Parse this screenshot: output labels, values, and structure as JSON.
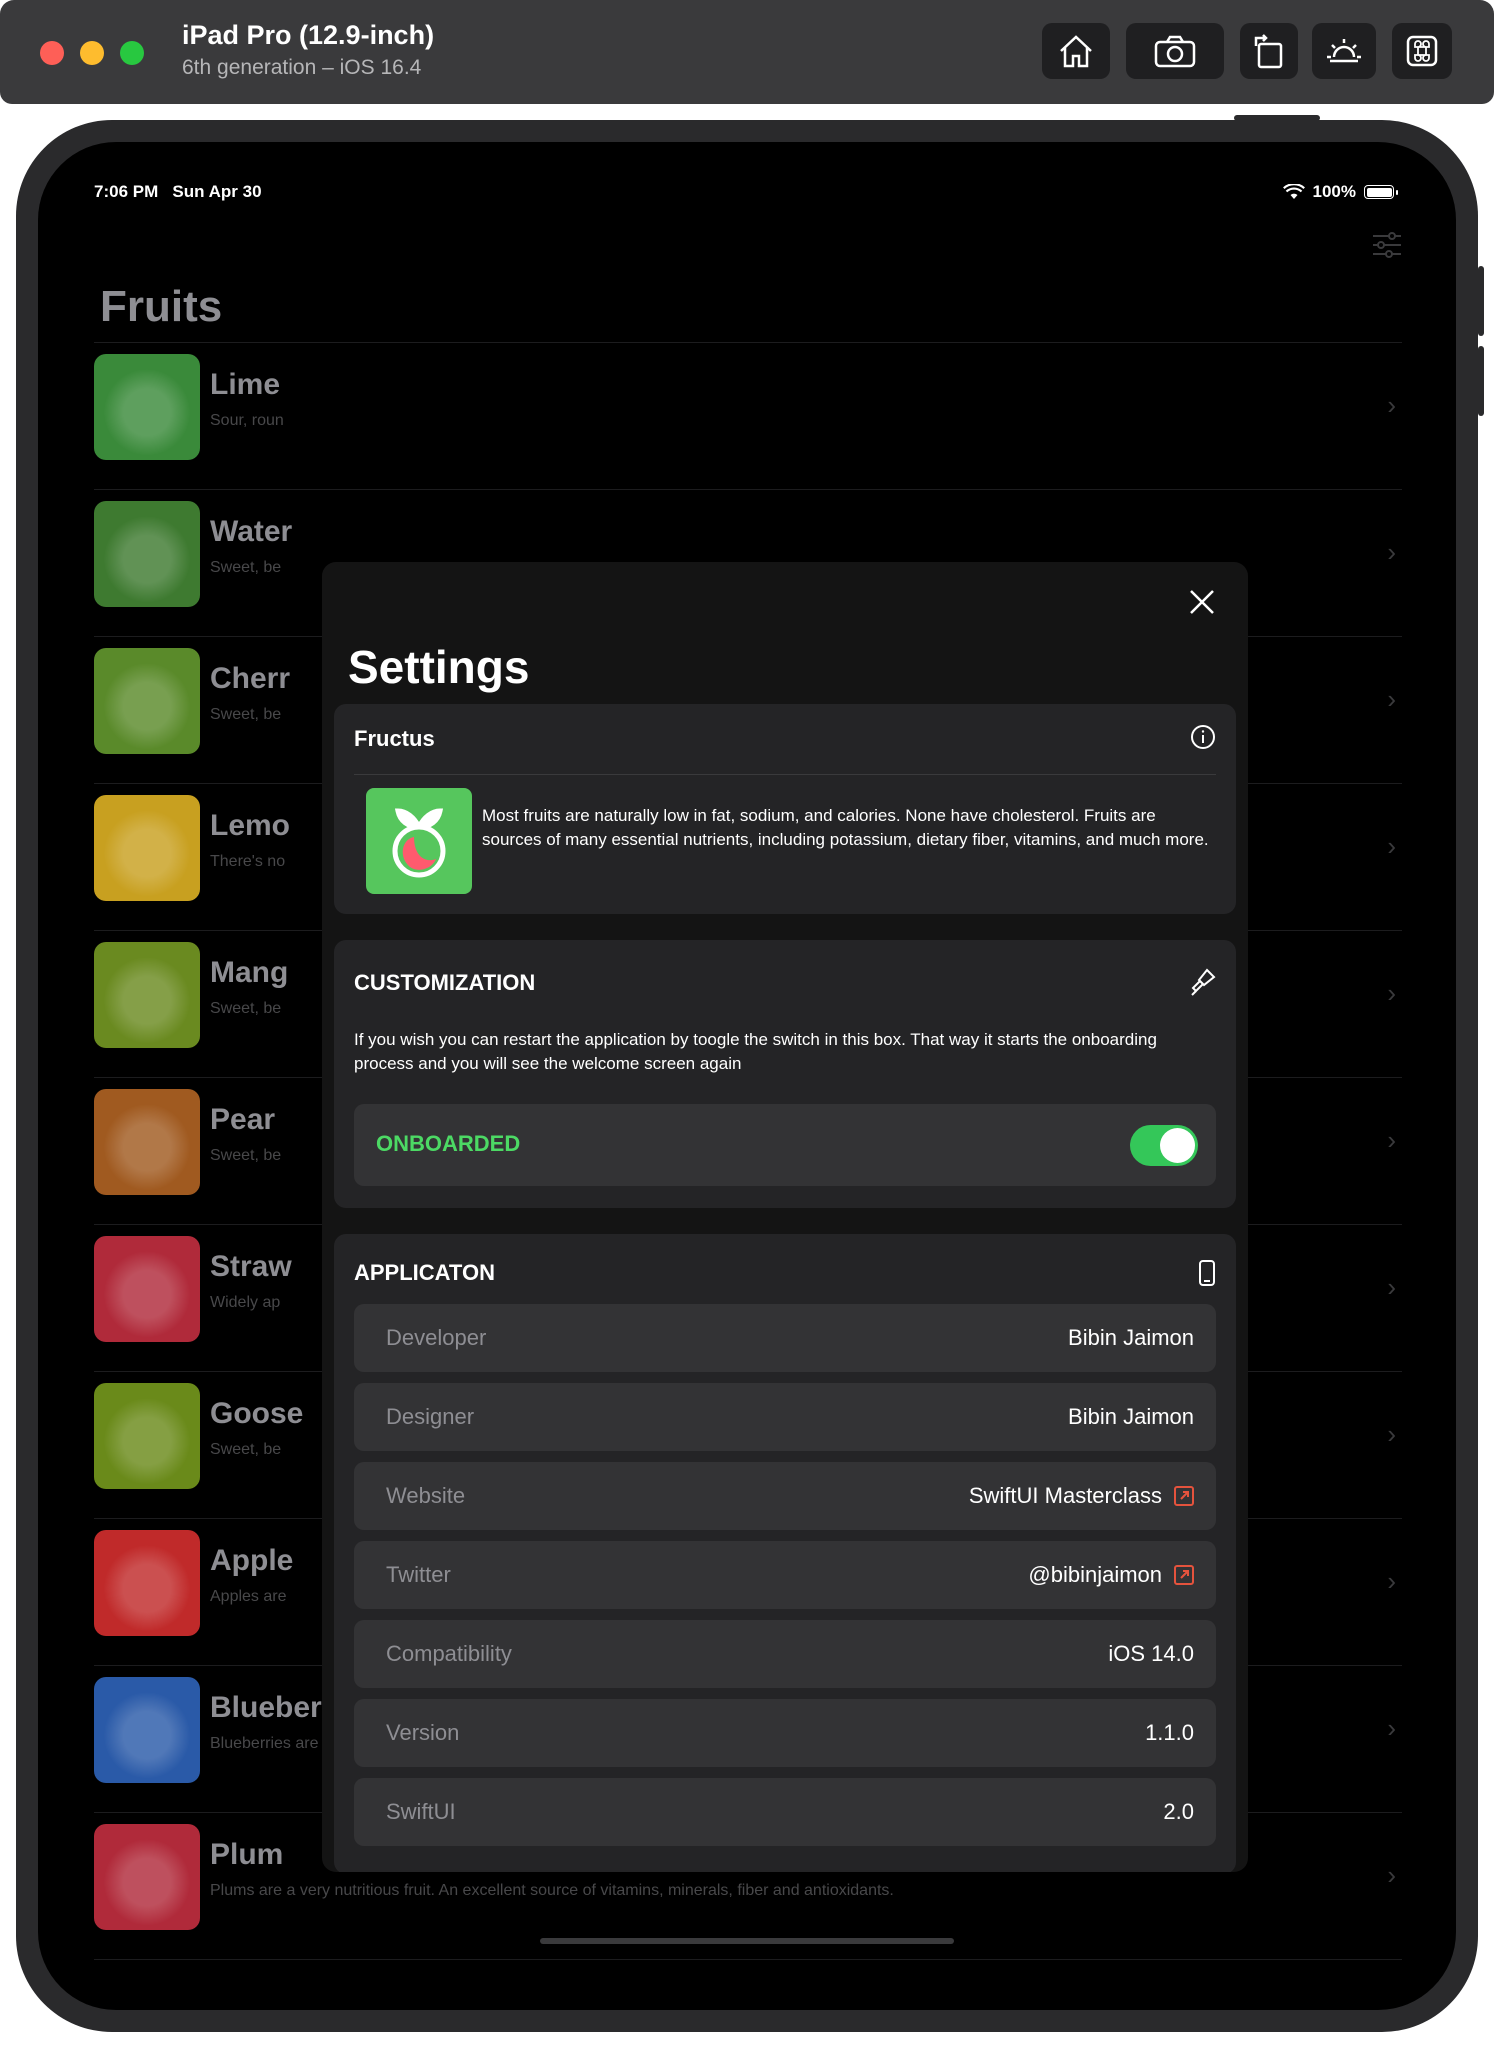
{
  "simulator": {
    "device_name": "iPad Pro (12.9-inch)",
    "device_subtitle": "6th generation – iOS 16.4",
    "toolbar": [
      "home-icon",
      "camera-icon",
      "rotate-icon",
      "brightness-icon",
      "command-icon"
    ]
  },
  "status_bar": {
    "time_date": "7:06 PM   Sun Apr 30",
    "battery": "100%"
  },
  "list": {
    "title": "Fruits",
    "items": [
      {
        "name": "Lime",
        "desc": "Sour, roun",
        "color": "#3a8a3a"
      },
      {
        "name": "Water",
        "desc": "Sweet, be",
        "color": "#3e7a30"
      },
      {
        "name": "Cherr",
        "desc": "Sweet, be",
        "color": "#5a8a2a"
      },
      {
        "name": "Lemo",
        "desc": "There's no",
        "color": "#c8a020"
      },
      {
        "name": "Mang",
        "desc": "Sweet, be",
        "color": "#6a8a20"
      },
      {
        "name": "Pear",
        "desc": "Sweet, be",
        "color": "#a05a20"
      },
      {
        "name": "Straw",
        "desc": "Widely ap",
        "color": "#b02a3a"
      },
      {
        "name": "Goose",
        "desc": "Sweet, be",
        "color": "#6a8a1a"
      },
      {
        "name": "Apple",
        "desc": "Apples are",
        "color": "#c02a2a"
      },
      {
        "name": "Blueberry",
        "desc": "Blueberries are sweet, nutritious and wildly popular fruit all over the world.",
        "color": "#2a5aa8"
      },
      {
        "name": "Plum",
        "desc": "Plums are a very nutritious fruit. An excellent source of vitamins, minerals, fiber and antioxidants.",
        "color": "#b02a3a"
      }
    ]
  },
  "settings": {
    "title": "Settings",
    "about": {
      "header": "Fructus",
      "text": "Most fruits are naturally low in fat, sodium, and calories. None have cholesterol. Fruits are sources of many essential nutrients, including potassium, dietary fiber, vitamins, and much more."
    },
    "customization": {
      "header": "CUSTOMIZATION",
      "text": "If you wish you can restart the application by toogle the switch in this box. That way it starts the onboarding process and you will see the welcome screen again",
      "toggle_label": "ONBOARDED",
      "toggle_on": true
    },
    "application": {
      "header": "APPLICATON",
      "rows": [
        {
          "key": "Developer",
          "value": "Bibin Jaimon",
          "link": false
        },
        {
          "key": "Designer",
          "value": "Bibin Jaimon",
          "link": false
        },
        {
          "key": "Website",
          "value": "SwiftUI Masterclass",
          "link": true
        },
        {
          "key": "Twitter",
          "value": "@bibinjaimon",
          "link": true
        },
        {
          "key": "Compatibility",
          "value": "iOS 14.0",
          "link": false
        },
        {
          "key": "Version",
          "value": "1.1.0",
          "link": false
        },
        {
          "key": "SwiftUI",
          "value": "2.0",
          "link": false
        }
      ]
    }
  },
  "colors": {
    "accent_green": "#34c759",
    "logo_green": "#56c65d",
    "link_red": "#e5533d"
  }
}
